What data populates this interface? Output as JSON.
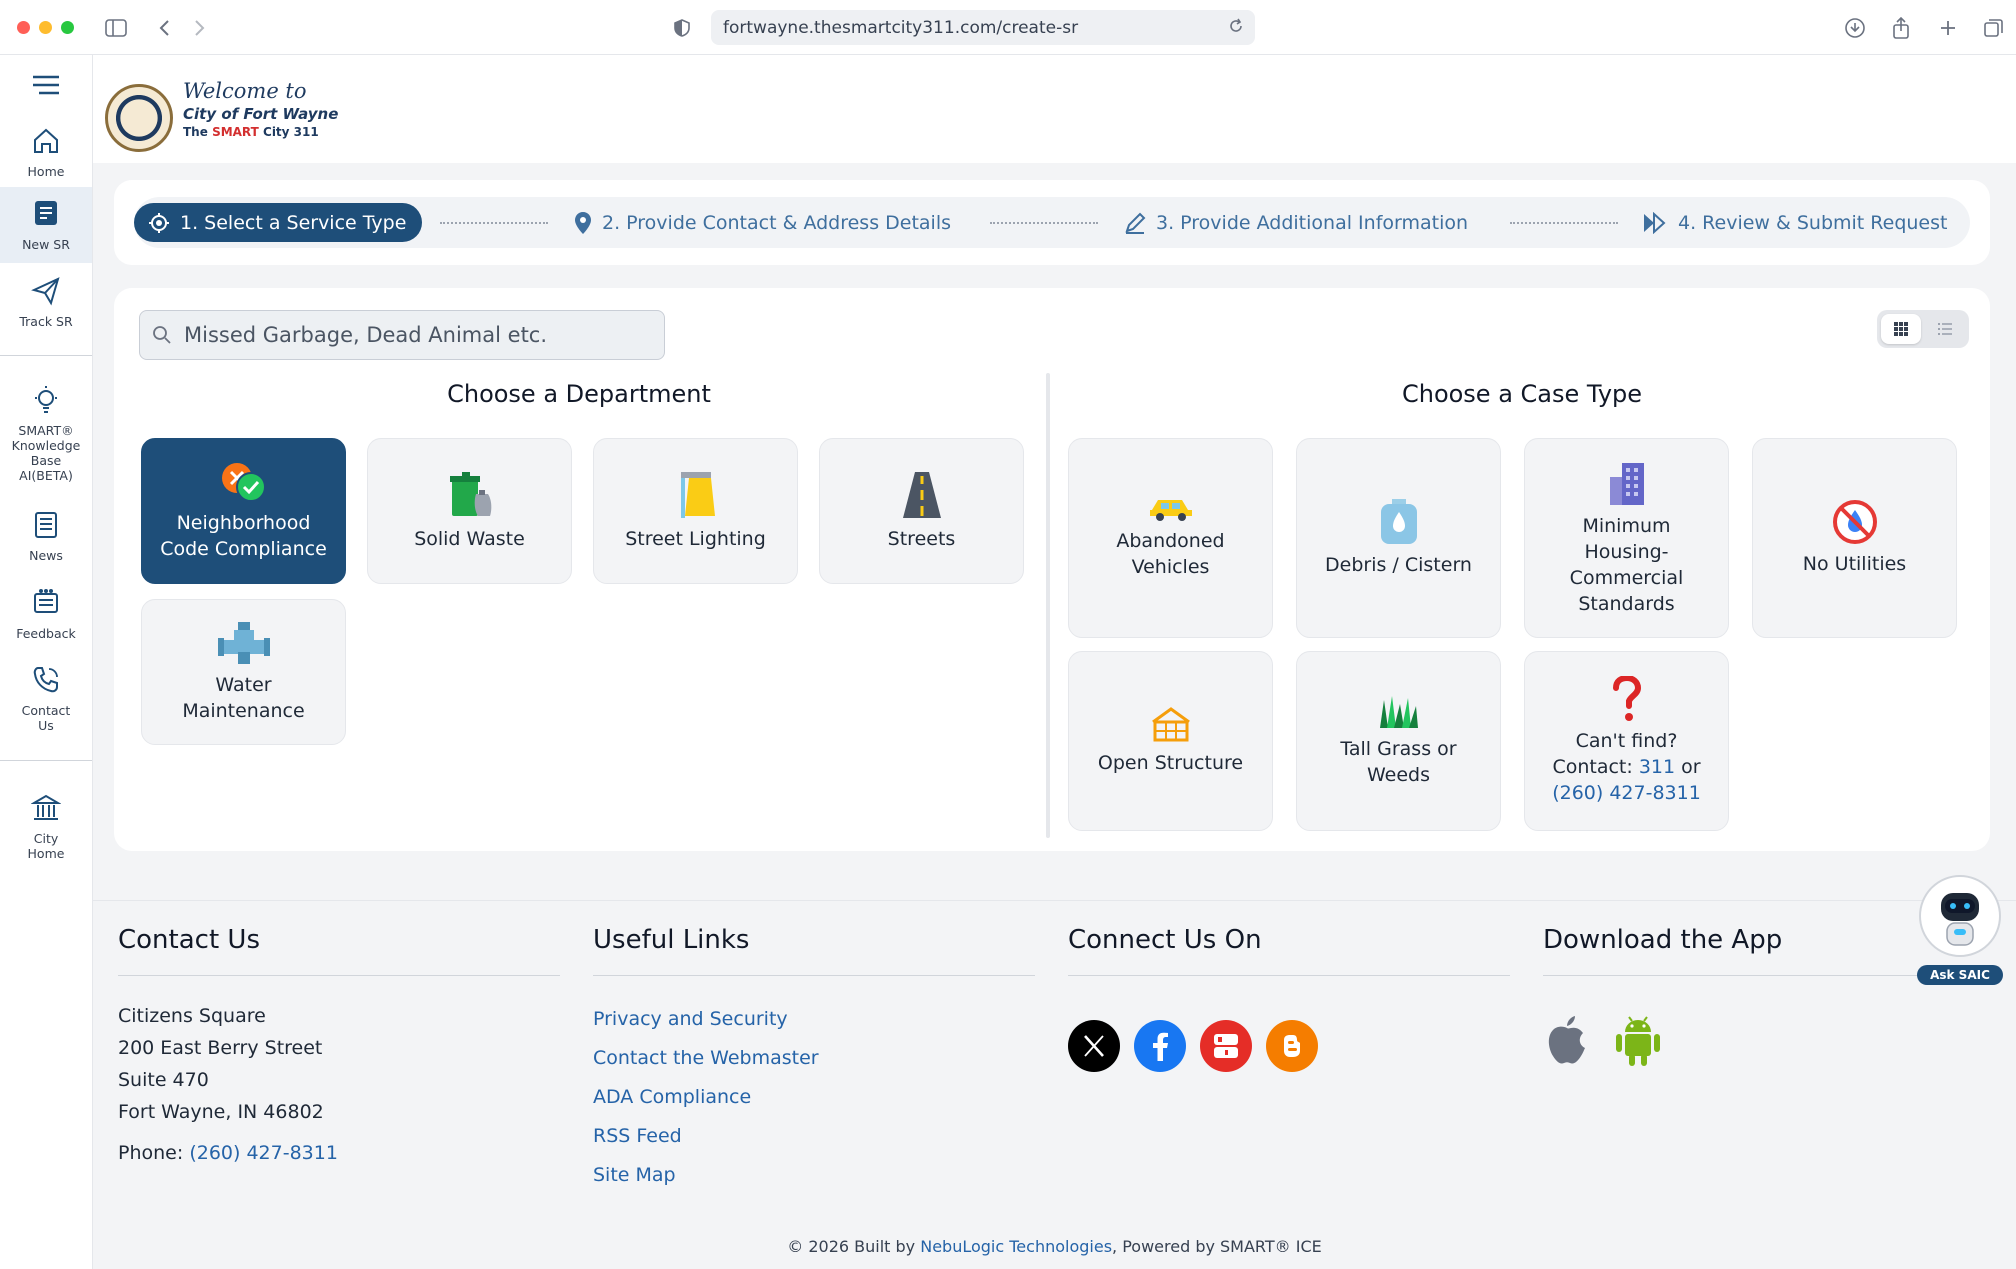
{
  "browser": {
    "url": "fortwayne.thesmartcity311.com/create-sr"
  },
  "rail": {
    "items": [
      {
        "label": "Home"
      },
      {
        "label": "New SR"
      },
      {
        "label": "Track SR"
      },
      {
        "label": "SMART® Knowledge Base AI(BETA)"
      },
      {
        "label": "News"
      },
      {
        "label": "Feedback"
      },
      {
        "label": "Contact Us"
      },
      {
        "label": "City Home"
      }
    ]
  },
  "header": {
    "welcome": "Welcome to",
    "city": "City of Fort Wayne",
    "smart_prefix": "The",
    "smart_brand": "SMART",
    "smart_suffix": "City 311"
  },
  "stepper": {
    "steps": [
      {
        "label": "1. Select a Service Type"
      },
      {
        "label": "2. Provide Contact & Address Details"
      },
      {
        "label": "3. Provide Additional Information"
      },
      {
        "label": "4. Review & Submit Request"
      }
    ]
  },
  "search": {
    "placeholder": "Missed Garbage, Dead Animal etc."
  },
  "departments": {
    "title": "Choose a Department",
    "items": [
      {
        "line1": "Neighborhood",
        "line2": "Code Compliance"
      },
      {
        "line1": "Solid Waste",
        "line2": ""
      },
      {
        "line1": "Street Lighting",
        "line2": ""
      },
      {
        "line1": "Streets",
        "line2": ""
      },
      {
        "line1": "Water",
        "line2": "Maintenance"
      }
    ]
  },
  "case_types": {
    "title": "Choose a Case Type",
    "items": [
      {
        "line1": "Abandoned",
        "line2": "Vehicles"
      },
      {
        "line1": "Debris / Cistern",
        "line2": ""
      },
      {
        "line1": "Minimum",
        "line2": "Housing-",
        "line3": "Commercial",
        "line4": "Standards"
      },
      {
        "line1": "No Utilities",
        "line2": ""
      },
      {
        "line1": "Open Structure",
        "line2": ""
      },
      {
        "line1": "Tall Grass or",
        "line2": "Weeds"
      }
    ],
    "cant_find": {
      "line1": "Can't find?",
      "contact_label": "Contact:",
      "contact_num": "311",
      "or": "or",
      "phone": "(260) 427-8311"
    }
  },
  "footer": {
    "contact": {
      "title": "Contact Us",
      "lines": [
        "Citizens Square",
        "200 East Berry Street",
        "Suite 470",
        "Fort Wayne, IN 46802"
      ],
      "phone_label": "Phone:",
      "phone": "(260) 427-8311"
    },
    "links": {
      "title": "Useful Links",
      "items": [
        "Privacy and Security",
        "Contact the Webmaster",
        "ADA Compliance",
        "RSS Feed",
        "Site Map"
      ]
    },
    "connect": {
      "title": "Connect Us On"
    },
    "download": {
      "title": "Download the App"
    },
    "copyright_prefix": "© 2026 Built by",
    "copyright_company": "NebuLogic Technologies",
    "copyright_suffix": ", Powered by SMART® ICE"
  },
  "assistant": {
    "label": "Ask SAIC"
  },
  "colors": {
    "primary": "#1e4e79",
    "link": "#2563a8"
  }
}
